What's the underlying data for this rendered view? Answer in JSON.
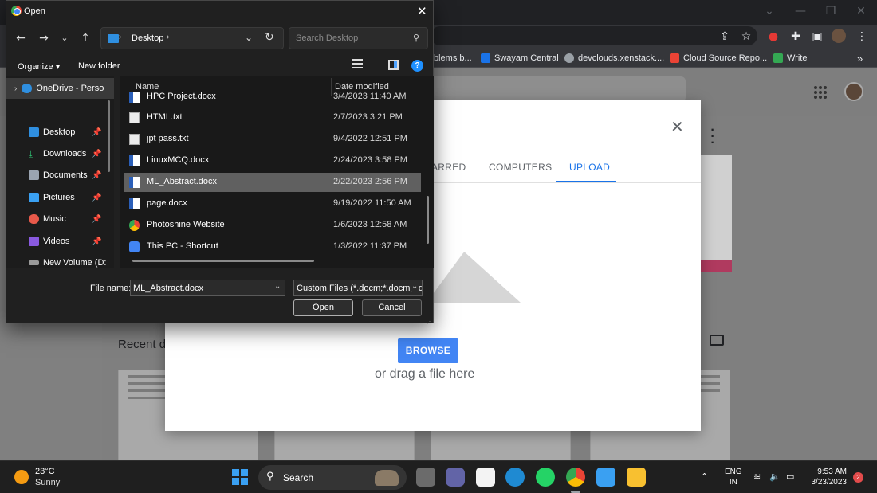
{
  "browser": {
    "bookmarks": [
      {
        "label": "blems b...",
        "color": "#e8eaed"
      },
      {
        "label": "Swayam Central",
        "color": "#1a73e8"
      },
      {
        "label": "devclouds.xenstack....",
        "color": "#9aa0a6"
      },
      {
        "label": "Cloud Source Repo...",
        "color": "#ea4335"
      },
      {
        "label": "Write",
        "color": "#34a853"
      }
    ]
  },
  "drive": {
    "recent_label": "Recent d",
    "tabs": [
      "ARRED",
      "COMPUTERS",
      "UPLOAD"
    ],
    "active_tab": "UPLOAD",
    "browse_label": "BROWSE",
    "drag_text": "or drag a file here"
  },
  "dialog": {
    "title": "Open",
    "path": "Desktop",
    "search_placeholder": "Search Desktop",
    "organize_label": "Organize ▾",
    "new_folder_label": "New folder",
    "nav_items": [
      {
        "label": "OneDrive - Perso",
        "icon": "cloud-icon",
        "color": "#2f8fe0",
        "pinned": false
      },
      {
        "label": "Desktop",
        "icon": "desktop-icon",
        "color": "#2f8fe0",
        "pinned": true
      },
      {
        "label": "Downloads",
        "icon": "download-icon",
        "color": "#2fbf71",
        "pinned": true
      },
      {
        "label": "Documents",
        "icon": "documents-icon",
        "color": "#9aa4b1",
        "pinned": true
      },
      {
        "label": "Pictures",
        "icon": "pictures-icon",
        "color": "#3aa0f2",
        "pinned": true
      },
      {
        "label": "Music",
        "icon": "music-icon",
        "color": "#e8594a",
        "pinned": true
      },
      {
        "label": "Videos",
        "icon": "videos-icon",
        "color": "#8a5ae0",
        "pinned": true
      },
      {
        "label": "New Volume (D:",
        "icon": "drive-icon",
        "color": "#9a9a9a",
        "pinned": false
      }
    ],
    "columns": {
      "name": "Name",
      "date": "Date modified"
    },
    "files": [
      {
        "name": "HPC Project.docx",
        "date": "3/4/2023 11:40 AM",
        "type": "doc"
      },
      {
        "name": "HTML.txt",
        "date": "2/7/2023 3:21 PM",
        "type": "txt"
      },
      {
        "name": "jpt pass.txt",
        "date": "9/4/2022 12:51 PM",
        "type": "txt"
      },
      {
        "name": "LinuxMCQ.docx",
        "date": "2/24/2023 3:58 PM",
        "type": "doc"
      },
      {
        "name": "ML_Abstract.docx",
        "date": "2/22/2023 2:56 PM",
        "type": "doc",
        "selected": true
      },
      {
        "name": "page.docx",
        "date": "9/19/2022 11:50 AM",
        "type": "doc"
      },
      {
        "name": "Photoshine Website",
        "date": "1/6/2023 12:58 AM",
        "type": "chrome"
      },
      {
        "name": "This PC - Shortcut",
        "date": "1/3/2022 11:37 PM",
        "type": "lnk"
      }
    ],
    "file_name_label": "File name:",
    "file_name_value": "ML_Abstract.docx",
    "file_type_value": "Custom Files (*.docm;*.docm;*.d",
    "open_label": "Open",
    "cancel_label": "Cancel"
  },
  "taskbar": {
    "temperature": "23°C",
    "weather": "Sunny",
    "search_label": "Search",
    "language_line1": "ENG",
    "language_line2": "IN",
    "time": "9:53 AM",
    "date": "3/23/2023",
    "notification_count": "2",
    "apps": [
      {
        "name": "task-view-icon",
        "color": "#6b6b6b"
      },
      {
        "name": "teams-icon",
        "color": "#6264a7"
      },
      {
        "name": "store-icon",
        "color": "#f3f3f3"
      },
      {
        "name": "edge-icon",
        "color": "#1f8ad2"
      },
      {
        "name": "whatsapp-icon",
        "color": "#25d366"
      },
      {
        "name": "chrome-icon",
        "color": "#fbbc05"
      },
      {
        "name": "notepad-icon",
        "color": "#3aa0f2"
      },
      {
        "name": "file-explorer-icon",
        "color": "#f8c030"
      }
    ]
  }
}
